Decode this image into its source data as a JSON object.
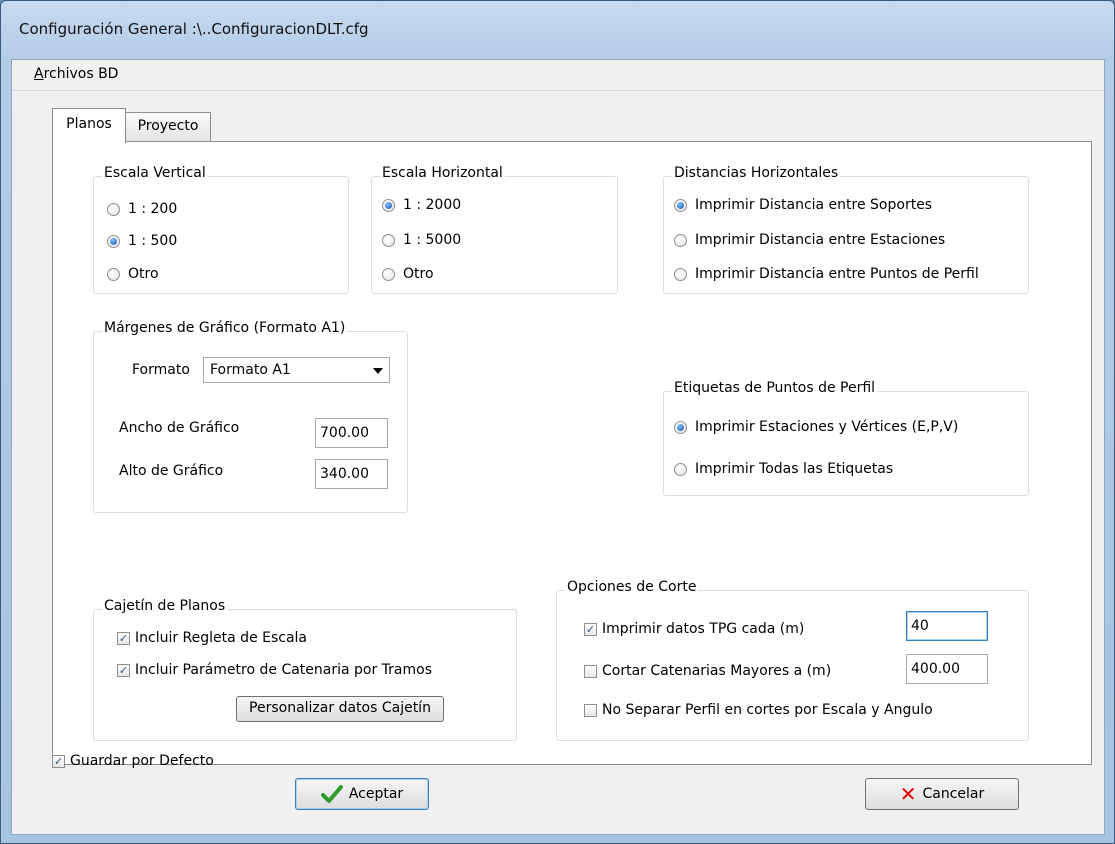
{
  "window": {
    "title": "Configuración General :\\..ConfiguracionDLT.cfg"
  },
  "menu": {
    "archivos_bd": "Archivos BD"
  },
  "tabs": [
    {
      "label": "Planos"
    },
    {
      "label": "Proyecto"
    }
  ],
  "escala_vertical": {
    "title": "Escala Vertical",
    "options": [
      {
        "label": "1 : 200",
        "checked": false
      },
      {
        "label": "1 : 500",
        "checked": true
      },
      {
        "label": "Otro",
        "checked": false
      }
    ]
  },
  "escala_horizontal": {
    "title": "Escala Horizontal",
    "options": [
      {
        "label": "1 : 2000",
        "checked": true
      },
      {
        "label": "1 : 5000",
        "checked": false
      },
      {
        "label": "Otro",
        "checked": false
      }
    ]
  },
  "distancias_horizontales": {
    "title": "Distancias Horizontales",
    "options": [
      {
        "label": "Imprimir Distancia entre Soportes",
        "checked": true
      },
      {
        "label": "Imprimir Distancia entre Estaciones",
        "checked": false
      },
      {
        "label": "Imprimir Distancia entre Puntos de Perfil",
        "checked": false
      }
    ]
  },
  "margenes": {
    "title": "Márgenes de Gráfico (Formato  A1)",
    "formato_label": "Formato",
    "formato_value": "Formato A1",
    "ancho_label": "Ancho de Gráfico",
    "ancho_value": "700.00",
    "alto_label": "Alto de Gráfico",
    "alto_value": "340.00"
  },
  "etiquetas": {
    "title": "Etiquetas de Puntos de Perfil",
    "options": [
      {
        "label": "Imprimir Estaciones y Vértices (E,P,V)",
        "checked": true
      },
      {
        "label": "Imprimir Todas las Etiquetas",
        "checked": false
      }
    ]
  },
  "cajetin": {
    "title": "Cajetín de Planos",
    "checkboxes": [
      {
        "label": "Incluir Regleta de Escala",
        "checked": true
      },
      {
        "label": "Incluir Parámetro de Catenaria por Tramos",
        "checked": true
      }
    ],
    "button": "Personalizar datos Cajetín"
  },
  "opciones_corte": {
    "title": "Opciones de Corte",
    "checkboxes": [
      {
        "label": "Imprimir datos TPG cada (m)",
        "checked": true,
        "value": "40"
      },
      {
        "label": "Cortar Catenarias Mayores a  (m)",
        "checked": false,
        "value": "400.00"
      },
      {
        "label": "No Separar Perfil en cortes  por Escala y Angulo",
        "checked": false
      }
    ]
  },
  "guardar_por_defecto": {
    "label": "Guardar por Defecto",
    "checked": true
  },
  "buttons": {
    "aceptar": "Aceptar",
    "cancelar": "Cancelar"
  },
  "check_mark": "✓",
  "colors": {
    "accent": "#1a56b0",
    "ok_icon": "#2e9a2e",
    "cancel_icon": "#e00000"
  }
}
